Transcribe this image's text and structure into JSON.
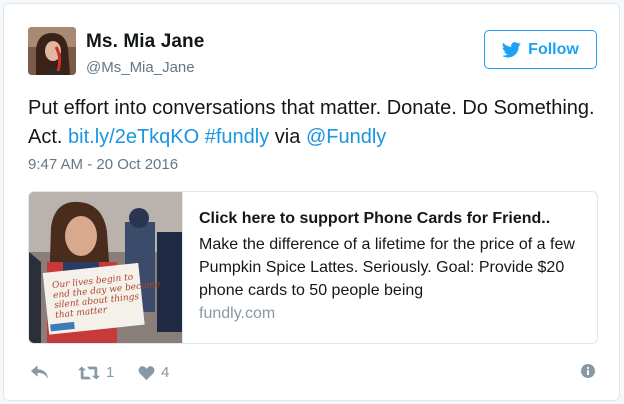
{
  "user": {
    "display_name": "Ms. Mia Jane",
    "handle": "@Ms_Mia_Jane"
  },
  "follow_button": {
    "label": "Follow",
    "icon": "twitter-bird-icon",
    "color": "#1da1f2"
  },
  "tweet": {
    "text_plain": "Put effort into conversations that matter. Donate. Do Something. Act. ",
    "link_url": "bit.ly/2eTkqKO",
    "hashtag": "#fundly",
    "via_text": " via ",
    "mention": "@Fundly",
    "timestamp": "9:47 AM - 20 Oct 2016"
  },
  "card": {
    "title": "Click here to support Phone Cards for Friend..",
    "description": "Make the difference of a lifetime for the price of a few Pumpkin Spice Lattes. Seriously.  Goal: Provide $20 phone cards to 50 people being",
    "domain": "fundly.com",
    "sign_text": "Our lives begin to end the day we become silent about things that matter"
  },
  "actions": {
    "reply_icon": "reply-icon",
    "retweet_icon": "retweet-icon",
    "retweet_count": "1",
    "like_icon": "heart-icon",
    "like_count": "4",
    "info_icon": "info-icon"
  },
  "colors": {
    "link": "#1b95e0",
    "muted": "#657786",
    "border": "#e1e8ed"
  }
}
